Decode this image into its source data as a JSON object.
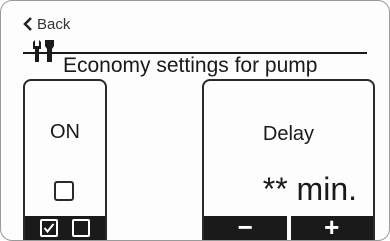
{
  "header": {
    "back_label": "Back",
    "title": "Economy settings for pump"
  },
  "left_panel": {
    "state_label": "ON",
    "checkbox_checked": false,
    "footer_toggles": [
      {
        "name": "checked-toggle",
        "checked": true
      },
      {
        "name": "unchecked-toggle",
        "checked": false
      }
    ]
  },
  "right_panel": {
    "label": "Delay",
    "value": "** min.",
    "minus_label": "−",
    "plus_label": "+"
  },
  "icons": {
    "back": "chevron-left-icon",
    "settings": "wrench-screwdriver-icon"
  }
}
